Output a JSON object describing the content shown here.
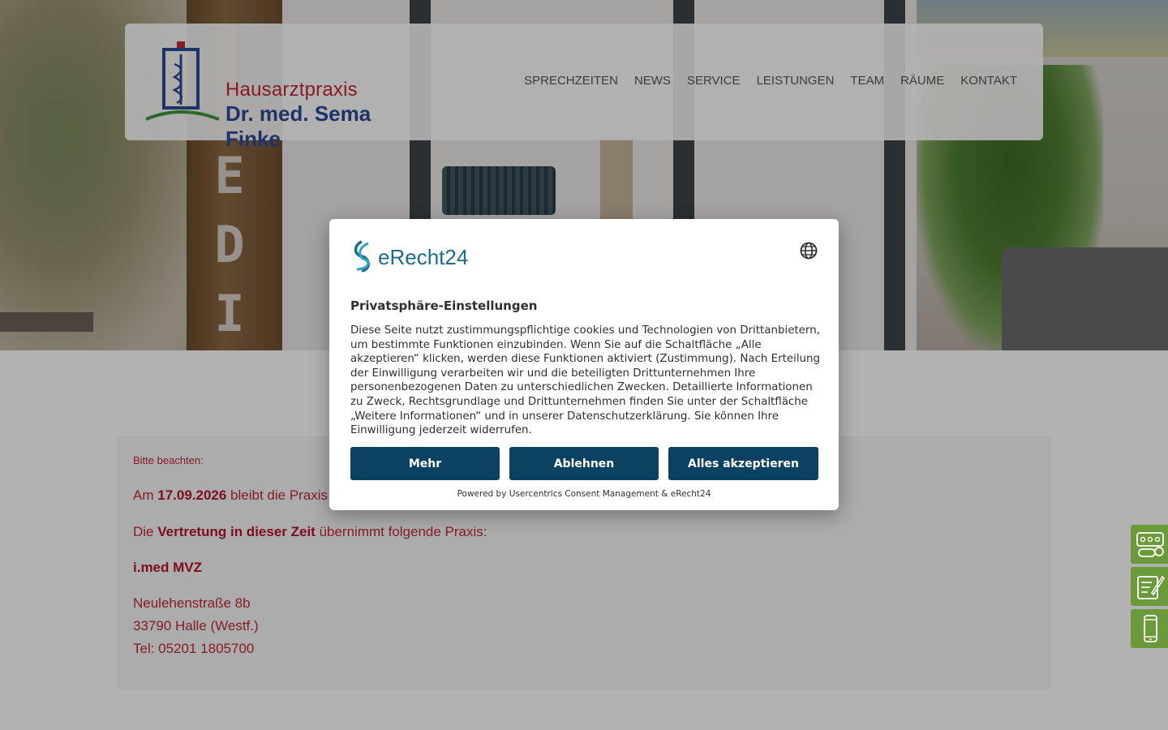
{
  "site": {
    "logo": {
      "line1": "Hausarztpraxis",
      "line2": "Dr. med. Sema Finke"
    },
    "nav": [
      {
        "label": "SPRECHZEITEN"
      },
      {
        "label": "NEWS"
      },
      {
        "label": "SERVICE"
      },
      {
        "label": "LEISTUNGEN"
      },
      {
        "label": "TEAM"
      },
      {
        "label": "RÄUME"
      },
      {
        "label": "KONTAKT"
      }
    ]
  },
  "notice": {
    "label": "Bitte beachten:",
    "line1_prefix": "Am ",
    "line1_date": "17.09.2026",
    "line1_suffix": " bleibt die Praxis",
    "line2_prefix": "Die ",
    "line2_bold": "Vertretung in dieser Zeit",
    "line2_suffix": " übernimmt folgende Praxis:",
    "practice_name": "i.med MVZ",
    "street": "Neulehenstraße 8b",
    "city": "33790 Halle (Westf.)",
    "phone": "Tel: 05201 1805700"
  },
  "consent": {
    "brand": "eRecht24",
    "title": "Privatsphäre-Einstellungen",
    "body": "Diese Seite nutzt zustimmungspflichtige cookies und Technologien von Drittanbietern, um bestimmte Funktionen einzubinden. Wenn Sie auf die Schaltfläche „Alle akzeptieren“ klicken, werden diese Funktionen aktiviert (Zustimmung). Nach Erteilung der Einwilligung verarbeiten wir und die beteiligten Drittunternehmen Ihre personenbezogenen Daten zu unterschiedlichen Zwecken. Detaillierte Informationen zu Zweck, Rechtsgrundlage und Drittunternehmen finden Sie unter der Schaltfläche „Weitere Informationen“ und in unserer Datenschutzerklärung. Sie können Ihre Einwilligung jederzeit widerrufen.",
    "buttons": {
      "more": "Mehr",
      "decline": "Ablehnen",
      "accept_all": "Alles akzeptieren"
    },
    "powered_by": "Powered by Usercentrics Consent Management & eRecht24"
  },
  "side_buttons": [
    {
      "icon": "pills-icon"
    },
    {
      "icon": "prescription-edit-icon"
    },
    {
      "icon": "smartphone-icon"
    }
  ],
  "colors": {
    "accent_red": "#c0283a",
    "logo_blue": "#2b4b95",
    "button_navy": "#0b4262",
    "side_green": "#6a9a3a"
  }
}
